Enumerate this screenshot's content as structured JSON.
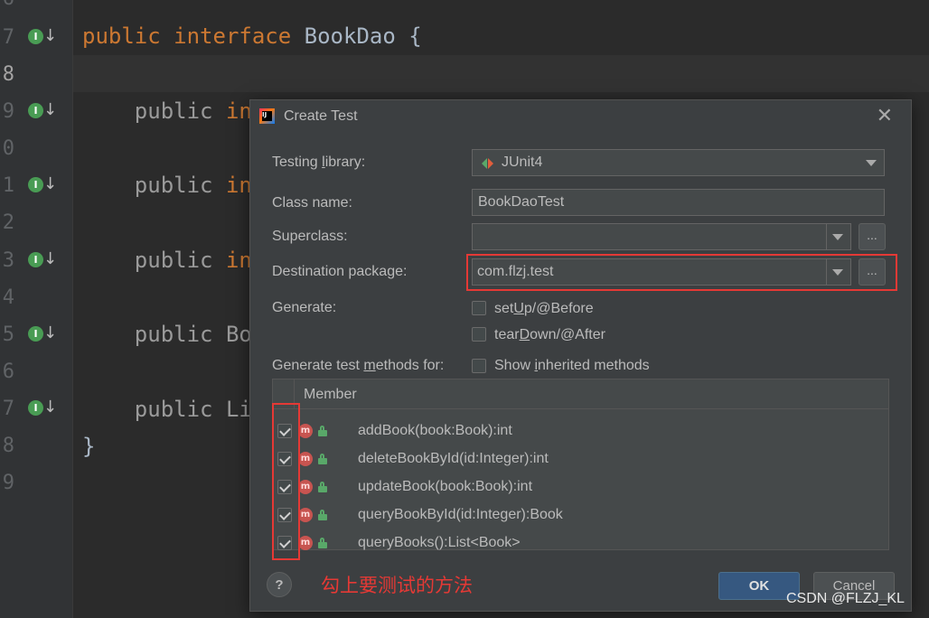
{
  "editor": {
    "line_numbers": [
      "6",
      "7",
      "8",
      "9",
      "0",
      "1",
      "2",
      "3",
      "4",
      "5",
      "6",
      "7",
      "8",
      "9"
    ],
    "code": {
      "l7": {
        "kw1": "public",
        "kw2": "interface",
        "name": "BookDao",
        "brace": "{"
      },
      "l9": {
        "kw": "public",
        "rest": "in"
      },
      "l11": {
        "kw": "public",
        "rest": "in"
      },
      "l13": {
        "kw": "public",
        "rest": "in"
      },
      "l15": {
        "kw": "public",
        "rest": "Bo"
      },
      "l17": {
        "kw": "public",
        "rest": "Li"
      },
      "l18": {
        "brace": "}"
      }
    },
    "impl_marker_letter": "I",
    "impl_marker_arrow": "↓"
  },
  "dialog": {
    "title": "Create Test",
    "close_symbol": "✕",
    "logo_text": "IJ",
    "testing_library": {
      "label_pre": "Testing ",
      "label_u": "l",
      "label_post": "ibrary:",
      "value": "JUnit4"
    },
    "class_name": {
      "label": "Class name:",
      "value": "BookDaoTest"
    },
    "superclass": {
      "label": "Superclass:",
      "value": ""
    },
    "destination_package": {
      "label": "Destination package:",
      "value": "com.flzj.test"
    },
    "ellipsis": "...",
    "generate": {
      "label": "Generate:",
      "setup": {
        "pre": "set",
        "u": "U",
        "post": "p/@Before",
        "checked": false
      },
      "teardown": {
        "pre": "tear",
        "u": "D",
        "post": "own/@After",
        "checked": false
      }
    },
    "generate_methods": {
      "label_pre": "Generate test ",
      "label_u": "m",
      "label_post": "ethods for:"
    },
    "show_inherited": {
      "pre": "Show ",
      "u": "i",
      "post": "nherited methods",
      "checked": false
    },
    "table": {
      "header": "Member",
      "method_icon_letter": "m",
      "rows": [
        {
          "name": "addBook(book:Book):int",
          "checked": true
        },
        {
          "name": "deleteBookById(id:Integer):int",
          "checked": true
        },
        {
          "name": "updateBook(book:Book):int",
          "checked": true
        },
        {
          "name": "queryBookById(id:Integer):Book",
          "checked": true
        },
        {
          "name": "queryBooks():List<Book>",
          "checked": true
        }
      ]
    },
    "help_symbol": "?",
    "annotation": "勾上要测试的方法",
    "ok_label": "OK",
    "cancel_label": "Cancel"
  },
  "watermark": "CSDN @FLZJ_KL",
  "colors": {
    "editor_bg": "#2b2b2b",
    "keyword": "#cc7832",
    "dialog_bg": "#3c3f41",
    "highlight_red": "#e53935",
    "ok_button": "#365880"
  }
}
